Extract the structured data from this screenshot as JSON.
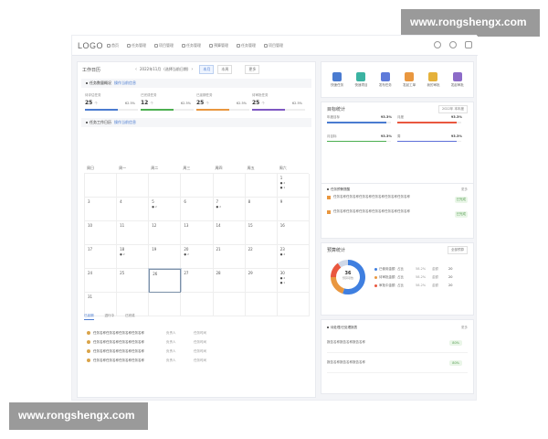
{
  "watermark": "www.rongshengx.com",
  "topbar": {
    "logo": "LOGO",
    "nav": [
      {
        "label": "首页"
      },
      {
        "label": "任务管理"
      },
      {
        "label": "项目管理"
      },
      {
        "label": "任务管理"
      },
      {
        "label": "预算管理"
      },
      {
        "label": "任务管理"
      },
      {
        "label": "项目管理"
      }
    ],
    "icons": [
      "notification-icon",
      "bell-icon",
      "message-icon"
    ]
  },
  "left": {
    "title": "工作日历",
    "date": "2022年11月",
    "date_extra": "(选择当前日期)",
    "btn_month": "本月",
    "btn_week": "本周",
    "btn_more": "更多",
    "stats_section": {
      "title": "任务数量概况",
      "link": "操作当前信息"
    },
    "stats": [
      {
        "label": "待评估任务",
        "value": "25",
        "unit": "个",
        "pct": "62.5%",
        "color": "#4a7bd0",
        "fill": 0.62
      },
      {
        "label": "已完成任务",
        "value": "12",
        "unit": "个",
        "pct": "62.5%",
        "color": "#4caf50",
        "fill": 0.62
      },
      {
        "label": "已延期任务",
        "value": "25",
        "unit": "个",
        "pct": "62.5%",
        "color": "#e9973f",
        "fill": 0.62
      },
      {
        "label": "待审批任务",
        "value": "25",
        "unit": "个",
        "pct": "62.5%",
        "color": "#7e57c2",
        "fill": 0.62
      }
    ],
    "calendar_section": {
      "title": "任务工作日历",
      "link": "操作当前信息"
    },
    "weekdays": [
      "周日",
      "周一",
      "周二",
      "周三",
      "周四",
      "周五",
      "周六"
    ],
    "days": [
      {
        "d": "",
        "e": []
      },
      {
        "d": "",
        "e": []
      },
      {
        "d": "",
        "e": []
      },
      {
        "d": "",
        "e": []
      },
      {
        "d": "",
        "e": []
      },
      {
        "d": "",
        "e": []
      },
      {
        "d": "1",
        "e": [
          "2",
          "1"
        ]
      },
      {
        "d": "3",
        "e": []
      },
      {
        "d": "4",
        "e": []
      },
      {
        "d": "5",
        "e": [
          "2"
        ]
      },
      {
        "d": "6",
        "e": []
      },
      {
        "d": "7",
        "e": [
          "2"
        ]
      },
      {
        "d": "8",
        "e": []
      },
      {
        "d": "9",
        "e": []
      },
      {
        "d": "10",
        "e": []
      },
      {
        "d": "11",
        "e": []
      },
      {
        "d": "12",
        "e": []
      },
      {
        "d": "13",
        "e": []
      },
      {
        "d": "14",
        "e": []
      },
      {
        "d": "15",
        "e": []
      },
      {
        "d": "16",
        "e": []
      },
      {
        "d": "17",
        "e": []
      },
      {
        "d": "18",
        "e": [
          "2"
        ]
      },
      {
        "d": "19",
        "e": []
      },
      {
        "d": "20",
        "e": [
          "2"
        ]
      },
      {
        "d": "21",
        "e": []
      },
      {
        "d": "22",
        "e": []
      },
      {
        "d": "23",
        "e": [
          "2"
        ]
      },
      {
        "d": "24",
        "e": []
      },
      {
        "d": "25",
        "e": []
      },
      {
        "d": "26",
        "e": []
      },
      {
        "d": "27",
        "e": []
      },
      {
        "d": "28",
        "e": []
      },
      {
        "d": "29",
        "e": []
      },
      {
        "d": "30",
        "e": [
          "2",
          "1"
        ]
      },
      {
        "d": "31",
        "e": []
      },
      {
        "d": "",
        "e": []
      },
      {
        "d": "",
        "e": []
      },
      {
        "d": "",
        "e": []
      },
      {
        "d": "",
        "e": []
      },
      {
        "d": "",
        "e": []
      },
      {
        "d": "",
        "e": []
      }
    ],
    "today": "26",
    "tabs": [
      "已延期",
      "进行中",
      "已完成"
    ],
    "todos": [
      {
        "title": "任务名称任务名称任务名称任务名称",
        "owner": "负责人",
        "time": "任务时间"
      },
      {
        "title": "任务名称任务名称任务名称任务名称",
        "owner": "负责人",
        "time": "任务时间"
      },
      {
        "title": "任务名称任务名称任务名称任务名称",
        "owner": "负责人",
        "time": "任务时间"
      },
      {
        "title": "任务名称任务名称任务名称任务名称",
        "owner": "负责人",
        "time": "任务时间"
      }
    ]
  },
  "right": {
    "shortcuts": [
      {
        "label": "快速任务",
        "color": "#4a7bd0"
      },
      {
        "label": "快速项目",
        "color": "#3bb3a2"
      },
      {
        "label": "发布任务",
        "color": "#5e7ad9"
      },
      {
        "label": "发起工单",
        "color": "#e9973f"
      },
      {
        "label": "我的审批",
        "color": "#e5b13a"
      },
      {
        "label": "发起审批",
        "color": "#8c6bc8"
      }
    ],
    "achievement": {
      "title": "目标统计",
      "period": "2022年 本年度",
      "items": [
        {
          "label": "年度目标",
          "pct": "93.3%",
          "color": "#4a7bd0",
          "fill": 0.93
        },
        {
          "label": "月度",
          "pct": "93.3%",
          "color": "#e9573f",
          "fill": 0.93
        },
        {
          "label": "月目标",
          "pct": "93.3%",
          "color": "#4caf50",
          "fill": 0.93
        },
        {
          "label": "周",
          "pct": "93.3%",
          "color": "#5e6fd9",
          "fill": 0.93
        }
      ]
    },
    "alerts_section": {
      "title": "任务预警提醒",
      "more": "更多"
    },
    "alerts": [
      {
        "text": "任务名称任务名称任务名称任务名称任务名称任务名称",
        "tag": "已完成"
      },
      {
        "text": "任务名称任务名称任务名称任务名称任务名称任务名称",
        "tag": "已完成"
      }
    ],
    "budget": {
      "title": "预算统计",
      "ctl": "全部预算",
      "center_value": "36",
      "center_label": "预算项数",
      "slices": [
        {
          "label": "已使用",
          "share": 0.55,
          "color": "#3f7fe0"
        },
        {
          "label": "待审批",
          "share": 0.2,
          "color": "#e9973f"
        },
        {
          "label": "审批中",
          "share": 0.15,
          "color": "#e9573f"
        },
        {
          "label": "其他",
          "share": 0.1,
          "color": "#cfd8e8"
        }
      ],
      "legend": [
        {
          "name": "已使用金额",
          "a": "占比",
          "b": "58.2%",
          "c": "金额",
          "d": "20",
          "color": "#3f7fe0"
        },
        {
          "name": "待审批金额",
          "a": "占比",
          "b": "58.2%",
          "c": "金额",
          "d": "20",
          "color": "#e9973f"
        },
        {
          "name": "审批中金额",
          "a": "占比",
          "b": "58.2%",
          "c": "金额",
          "d": "20",
          "color": "#e9573f"
        }
      ]
    },
    "attachments_section": {
      "title": "待处理/已处理报表",
      "more": "更多"
    },
    "attachments": [
      {
        "text": "报告名称报告名称报告名称",
        "badge": "80%"
      },
      {
        "text": "报告名称报告名称报告名称",
        "badge": "80%"
      }
    ]
  }
}
